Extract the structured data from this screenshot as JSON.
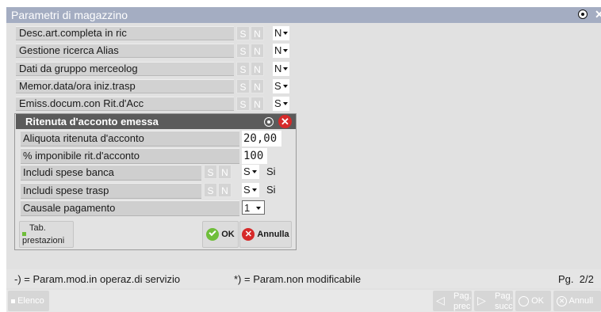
{
  "window": {
    "title": "Parametri di magazzino"
  },
  "params": [
    {
      "label": "Desc.art.completa in ric",
      "s": "S",
      "n": "N",
      "value": "N"
    },
    {
      "label": "Gestione ricerca Alias",
      "s": "S",
      "n": "N",
      "value": "N"
    },
    {
      "label": "Dati da gruppo merceolog",
      "s": "S",
      "n": "N",
      "value": "N"
    },
    {
      "label": "Memor.data/ora iniz.trasp",
      "s": "S",
      "n": "N",
      "value": "S"
    },
    {
      "label": "Emiss.docum.con Rit.d'Acc",
      "s": "S",
      "n": "N",
      "value": "S"
    }
  ],
  "dialog": {
    "title": "Ritenuta d'acconto emessa",
    "aliquota": {
      "label": "Aliquota ritenuta d'acconto",
      "value": "20,00"
    },
    "imponibile": {
      "label": "% imponibile rit.d'acconto",
      "value": "100"
    },
    "spese_banca": {
      "label": "Includi spese banca",
      "s": "S",
      "n": "N",
      "value": "S",
      "desc": "Si"
    },
    "spese_trasp": {
      "label": "Includi spese trasp",
      "s": "S",
      "n": "N",
      "value": "S",
      "desc": "Si"
    },
    "causale": {
      "label": "Causale pagamento",
      "value": "1"
    },
    "tab_button": {
      "line1": "Tab.",
      "line2": "prestazioni"
    },
    "ok_label": "OK",
    "annulla_label": "Annulla"
  },
  "footer": {
    "legend1": "-) = Param.mod.in operaz.di servizio",
    "legend2": "*) = Param.non modificabile",
    "page": "Pg.  2/2"
  },
  "bottom": {
    "elenco": "Elenco",
    "prev": {
      "line1": "Pag.",
      "line2": "prec"
    },
    "next": {
      "line1": "Pag.",
      "line2": "succ"
    },
    "ok": "OK",
    "annulla": "Annull"
  }
}
